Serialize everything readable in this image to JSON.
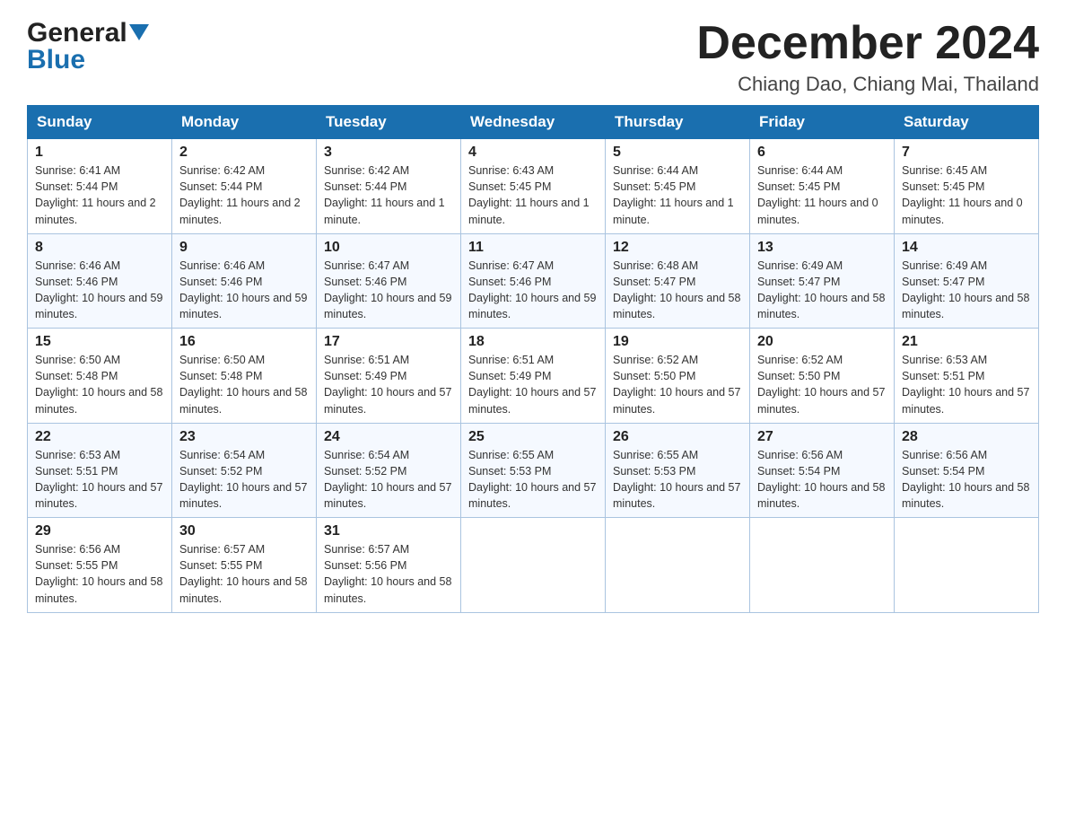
{
  "header": {
    "logo_general": "General",
    "logo_blue": "Blue",
    "month_title": "December 2024",
    "location": "Chiang Dao, Chiang Mai, Thailand"
  },
  "weekdays": [
    "Sunday",
    "Monday",
    "Tuesday",
    "Wednesday",
    "Thursday",
    "Friday",
    "Saturday"
  ],
  "weeks": [
    [
      {
        "day": "1",
        "sunrise": "6:41 AM",
        "sunset": "5:44 PM",
        "daylight": "11 hours and 2 minutes."
      },
      {
        "day": "2",
        "sunrise": "6:42 AM",
        "sunset": "5:44 PM",
        "daylight": "11 hours and 2 minutes."
      },
      {
        "day": "3",
        "sunrise": "6:42 AM",
        "sunset": "5:44 PM",
        "daylight": "11 hours and 1 minute."
      },
      {
        "day": "4",
        "sunrise": "6:43 AM",
        "sunset": "5:45 PM",
        "daylight": "11 hours and 1 minute."
      },
      {
        "day": "5",
        "sunrise": "6:44 AM",
        "sunset": "5:45 PM",
        "daylight": "11 hours and 1 minute."
      },
      {
        "day": "6",
        "sunrise": "6:44 AM",
        "sunset": "5:45 PM",
        "daylight": "11 hours and 0 minutes."
      },
      {
        "day": "7",
        "sunrise": "6:45 AM",
        "sunset": "5:45 PM",
        "daylight": "11 hours and 0 minutes."
      }
    ],
    [
      {
        "day": "8",
        "sunrise": "6:46 AM",
        "sunset": "5:46 PM",
        "daylight": "10 hours and 59 minutes."
      },
      {
        "day": "9",
        "sunrise": "6:46 AM",
        "sunset": "5:46 PM",
        "daylight": "10 hours and 59 minutes."
      },
      {
        "day": "10",
        "sunrise": "6:47 AM",
        "sunset": "5:46 PM",
        "daylight": "10 hours and 59 minutes."
      },
      {
        "day": "11",
        "sunrise": "6:47 AM",
        "sunset": "5:46 PM",
        "daylight": "10 hours and 59 minutes."
      },
      {
        "day": "12",
        "sunrise": "6:48 AM",
        "sunset": "5:47 PM",
        "daylight": "10 hours and 58 minutes."
      },
      {
        "day": "13",
        "sunrise": "6:49 AM",
        "sunset": "5:47 PM",
        "daylight": "10 hours and 58 minutes."
      },
      {
        "day": "14",
        "sunrise": "6:49 AM",
        "sunset": "5:47 PM",
        "daylight": "10 hours and 58 minutes."
      }
    ],
    [
      {
        "day": "15",
        "sunrise": "6:50 AM",
        "sunset": "5:48 PM",
        "daylight": "10 hours and 58 minutes."
      },
      {
        "day": "16",
        "sunrise": "6:50 AM",
        "sunset": "5:48 PM",
        "daylight": "10 hours and 58 minutes."
      },
      {
        "day": "17",
        "sunrise": "6:51 AM",
        "sunset": "5:49 PM",
        "daylight": "10 hours and 57 minutes."
      },
      {
        "day": "18",
        "sunrise": "6:51 AM",
        "sunset": "5:49 PM",
        "daylight": "10 hours and 57 minutes."
      },
      {
        "day": "19",
        "sunrise": "6:52 AM",
        "sunset": "5:50 PM",
        "daylight": "10 hours and 57 minutes."
      },
      {
        "day": "20",
        "sunrise": "6:52 AM",
        "sunset": "5:50 PM",
        "daylight": "10 hours and 57 minutes."
      },
      {
        "day": "21",
        "sunrise": "6:53 AM",
        "sunset": "5:51 PM",
        "daylight": "10 hours and 57 minutes."
      }
    ],
    [
      {
        "day": "22",
        "sunrise": "6:53 AM",
        "sunset": "5:51 PM",
        "daylight": "10 hours and 57 minutes."
      },
      {
        "day": "23",
        "sunrise": "6:54 AM",
        "sunset": "5:52 PM",
        "daylight": "10 hours and 57 minutes."
      },
      {
        "day": "24",
        "sunrise": "6:54 AM",
        "sunset": "5:52 PM",
        "daylight": "10 hours and 57 minutes."
      },
      {
        "day": "25",
        "sunrise": "6:55 AM",
        "sunset": "5:53 PM",
        "daylight": "10 hours and 57 minutes."
      },
      {
        "day": "26",
        "sunrise": "6:55 AM",
        "sunset": "5:53 PM",
        "daylight": "10 hours and 57 minutes."
      },
      {
        "day": "27",
        "sunrise": "6:56 AM",
        "sunset": "5:54 PM",
        "daylight": "10 hours and 58 minutes."
      },
      {
        "day": "28",
        "sunrise": "6:56 AM",
        "sunset": "5:54 PM",
        "daylight": "10 hours and 58 minutes."
      }
    ],
    [
      {
        "day": "29",
        "sunrise": "6:56 AM",
        "sunset": "5:55 PM",
        "daylight": "10 hours and 58 minutes."
      },
      {
        "day": "30",
        "sunrise": "6:57 AM",
        "sunset": "5:55 PM",
        "daylight": "10 hours and 58 minutes."
      },
      {
        "day": "31",
        "sunrise": "6:57 AM",
        "sunset": "5:56 PM",
        "daylight": "10 hours and 58 minutes."
      },
      null,
      null,
      null,
      null
    ]
  ]
}
